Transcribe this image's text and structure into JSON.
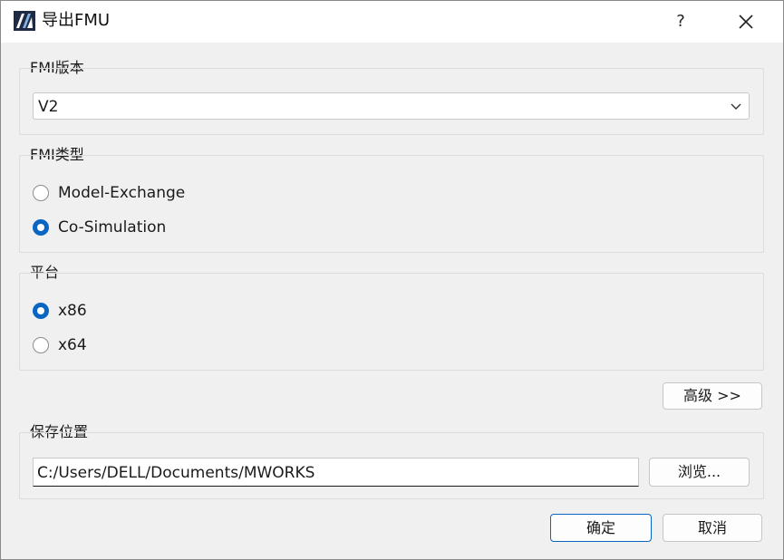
{
  "window": {
    "title": "导出FMU",
    "help_label": "?",
    "close_icon": "close-icon",
    "app_icon": "app-logo-icon"
  },
  "fmi_version": {
    "group_title": "FMI版本",
    "selected": "V2",
    "dropdown_icon": "chevron-down-icon"
  },
  "fmi_type": {
    "group_title": "FMI类型",
    "options": [
      {
        "label": "Model-Exchange",
        "selected": false
      },
      {
        "label": "Co-Simulation",
        "selected": true
      }
    ]
  },
  "platform": {
    "group_title": "平台",
    "options": [
      {
        "label": "x86",
        "selected": true
      },
      {
        "label": "x64",
        "selected": false
      }
    ]
  },
  "advanced_button_label": "高级 >>",
  "save_location": {
    "group_title": "保存位置",
    "path": "C:/Users/DELL/Documents/MWORKS",
    "browse_label": "浏览..."
  },
  "footer": {
    "ok_label": "确定",
    "cancel_label": "取消"
  },
  "colors": {
    "accent": "#0a66c2",
    "background": "#f0f0f0"
  }
}
